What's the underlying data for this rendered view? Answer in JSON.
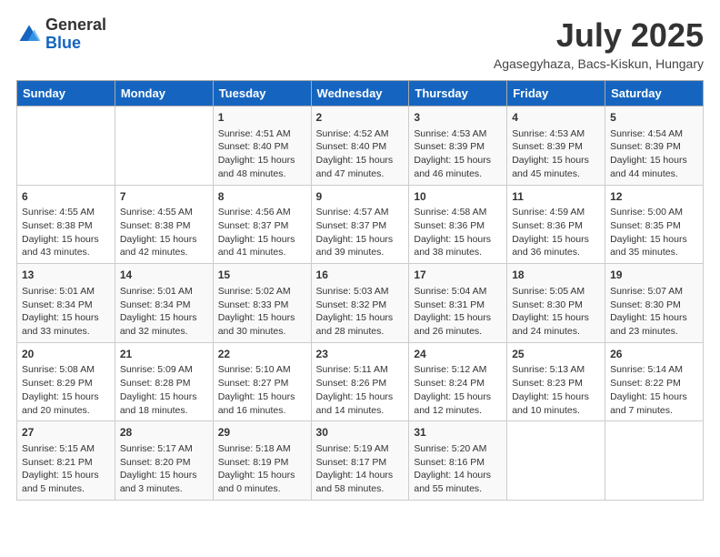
{
  "header": {
    "logo_general": "General",
    "logo_blue": "Blue",
    "month_title": "July 2025",
    "location": "Agasegyhaza, Bacs-Kiskun, Hungary"
  },
  "days_of_week": [
    "Sunday",
    "Monday",
    "Tuesday",
    "Wednesday",
    "Thursday",
    "Friday",
    "Saturday"
  ],
  "weeks": [
    [
      {
        "day": "",
        "info": ""
      },
      {
        "day": "",
        "info": ""
      },
      {
        "day": "1",
        "info": "Sunrise: 4:51 AM\nSunset: 8:40 PM\nDaylight: 15 hours and 48 minutes."
      },
      {
        "day": "2",
        "info": "Sunrise: 4:52 AM\nSunset: 8:40 PM\nDaylight: 15 hours and 47 minutes."
      },
      {
        "day": "3",
        "info": "Sunrise: 4:53 AM\nSunset: 8:39 PM\nDaylight: 15 hours and 46 minutes."
      },
      {
        "day": "4",
        "info": "Sunrise: 4:53 AM\nSunset: 8:39 PM\nDaylight: 15 hours and 45 minutes."
      },
      {
        "day": "5",
        "info": "Sunrise: 4:54 AM\nSunset: 8:39 PM\nDaylight: 15 hours and 44 minutes."
      }
    ],
    [
      {
        "day": "6",
        "info": "Sunrise: 4:55 AM\nSunset: 8:38 PM\nDaylight: 15 hours and 43 minutes."
      },
      {
        "day": "7",
        "info": "Sunrise: 4:55 AM\nSunset: 8:38 PM\nDaylight: 15 hours and 42 minutes."
      },
      {
        "day": "8",
        "info": "Sunrise: 4:56 AM\nSunset: 8:37 PM\nDaylight: 15 hours and 41 minutes."
      },
      {
        "day": "9",
        "info": "Sunrise: 4:57 AM\nSunset: 8:37 PM\nDaylight: 15 hours and 39 minutes."
      },
      {
        "day": "10",
        "info": "Sunrise: 4:58 AM\nSunset: 8:36 PM\nDaylight: 15 hours and 38 minutes."
      },
      {
        "day": "11",
        "info": "Sunrise: 4:59 AM\nSunset: 8:36 PM\nDaylight: 15 hours and 36 minutes."
      },
      {
        "day": "12",
        "info": "Sunrise: 5:00 AM\nSunset: 8:35 PM\nDaylight: 15 hours and 35 minutes."
      }
    ],
    [
      {
        "day": "13",
        "info": "Sunrise: 5:01 AM\nSunset: 8:34 PM\nDaylight: 15 hours and 33 minutes."
      },
      {
        "day": "14",
        "info": "Sunrise: 5:01 AM\nSunset: 8:34 PM\nDaylight: 15 hours and 32 minutes."
      },
      {
        "day": "15",
        "info": "Sunrise: 5:02 AM\nSunset: 8:33 PM\nDaylight: 15 hours and 30 minutes."
      },
      {
        "day": "16",
        "info": "Sunrise: 5:03 AM\nSunset: 8:32 PM\nDaylight: 15 hours and 28 minutes."
      },
      {
        "day": "17",
        "info": "Sunrise: 5:04 AM\nSunset: 8:31 PM\nDaylight: 15 hours and 26 minutes."
      },
      {
        "day": "18",
        "info": "Sunrise: 5:05 AM\nSunset: 8:30 PM\nDaylight: 15 hours and 24 minutes."
      },
      {
        "day": "19",
        "info": "Sunrise: 5:07 AM\nSunset: 8:30 PM\nDaylight: 15 hours and 23 minutes."
      }
    ],
    [
      {
        "day": "20",
        "info": "Sunrise: 5:08 AM\nSunset: 8:29 PM\nDaylight: 15 hours and 20 minutes."
      },
      {
        "day": "21",
        "info": "Sunrise: 5:09 AM\nSunset: 8:28 PM\nDaylight: 15 hours and 18 minutes."
      },
      {
        "day": "22",
        "info": "Sunrise: 5:10 AM\nSunset: 8:27 PM\nDaylight: 15 hours and 16 minutes."
      },
      {
        "day": "23",
        "info": "Sunrise: 5:11 AM\nSunset: 8:26 PM\nDaylight: 15 hours and 14 minutes."
      },
      {
        "day": "24",
        "info": "Sunrise: 5:12 AM\nSunset: 8:24 PM\nDaylight: 15 hours and 12 minutes."
      },
      {
        "day": "25",
        "info": "Sunrise: 5:13 AM\nSunset: 8:23 PM\nDaylight: 15 hours and 10 minutes."
      },
      {
        "day": "26",
        "info": "Sunrise: 5:14 AM\nSunset: 8:22 PM\nDaylight: 15 hours and 7 minutes."
      }
    ],
    [
      {
        "day": "27",
        "info": "Sunrise: 5:15 AM\nSunset: 8:21 PM\nDaylight: 15 hours and 5 minutes."
      },
      {
        "day": "28",
        "info": "Sunrise: 5:17 AM\nSunset: 8:20 PM\nDaylight: 15 hours and 3 minutes."
      },
      {
        "day": "29",
        "info": "Sunrise: 5:18 AM\nSunset: 8:19 PM\nDaylight: 15 hours and 0 minutes."
      },
      {
        "day": "30",
        "info": "Sunrise: 5:19 AM\nSunset: 8:17 PM\nDaylight: 14 hours and 58 minutes."
      },
      {
        "day": "31",
        "info": "Sunrise: 5:20 AM\nSunset: 8:16 PM\nDaylight: 14 hours and 55 minutes."
      },
      {
        "day": "",
        "info": ""
      },
      {
        "day": "",
        "info": ""
      }
    ]
  ]
}
